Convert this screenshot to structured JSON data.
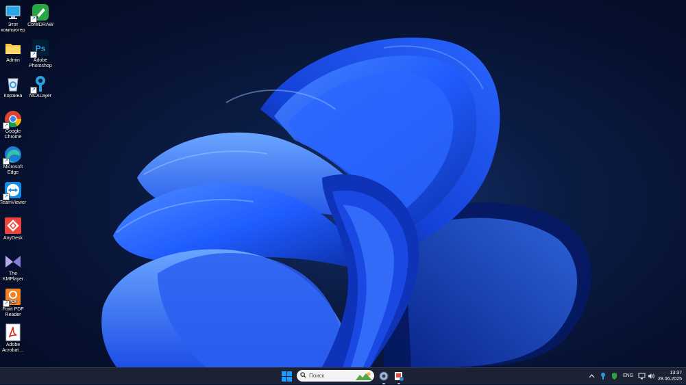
{
  "desktop": {
    "icons": [
      {
        "label": "Этот компьютер",
        "icon": "this-pc-icon"
      },
      {
        "label": "CorelDRAW",
        "icon": "coreldraw-icon"
      },
      {
        "label": "Admin",
        "icon": "folder-icon"
      },
      {
        "label": "Adobe Photoshop",
        "icon": "photoshop-icon",
        "glyph": "Ps"
      },
      {
        "label": "Корзина",
        "icon": "recycle-bin-icon"
      },
      {
        "label": "NCALayer",
        "icon": "ncalayer-icon"
      },
      {
        "label": "Google Chrome",
        "icon": "chrome-icon"
      },
      {
        "label": "Microsoft Edge",
        "icon": "edge-icon"
      },
      {
        "label": "TeamViewer",
        "icon": "teamviewer-icon"
      },
      {
        "label": "AnyDesk",
        "icon": "anydesk-icon"
      },
      {
        "label": "The KMPlayer",
        "icon": "kmplayer-icon"
      },
      {
        "label": "Foxit PDF Reader",
        "icon": "foxit-icon",
        "glyph": "PDF"
      },
      {
        "label": "Adobe Acrobat ...",
        "icon": "acrobat-icon"
      }
    ]
  },
  "taskbar": {
    "search_placeholder": "Поиск",
    "tray": {
      "language": "ENG"
    },
    "clock": {
      "time": "13:37",
      "date": "28.06.2025"
    }
  },
  "colors": {
    "accent": "#1e9bff",
    "taskbar_bg": "#1c2233",
    "wallpaper_bloom": "#1f5cff"
  }
}
